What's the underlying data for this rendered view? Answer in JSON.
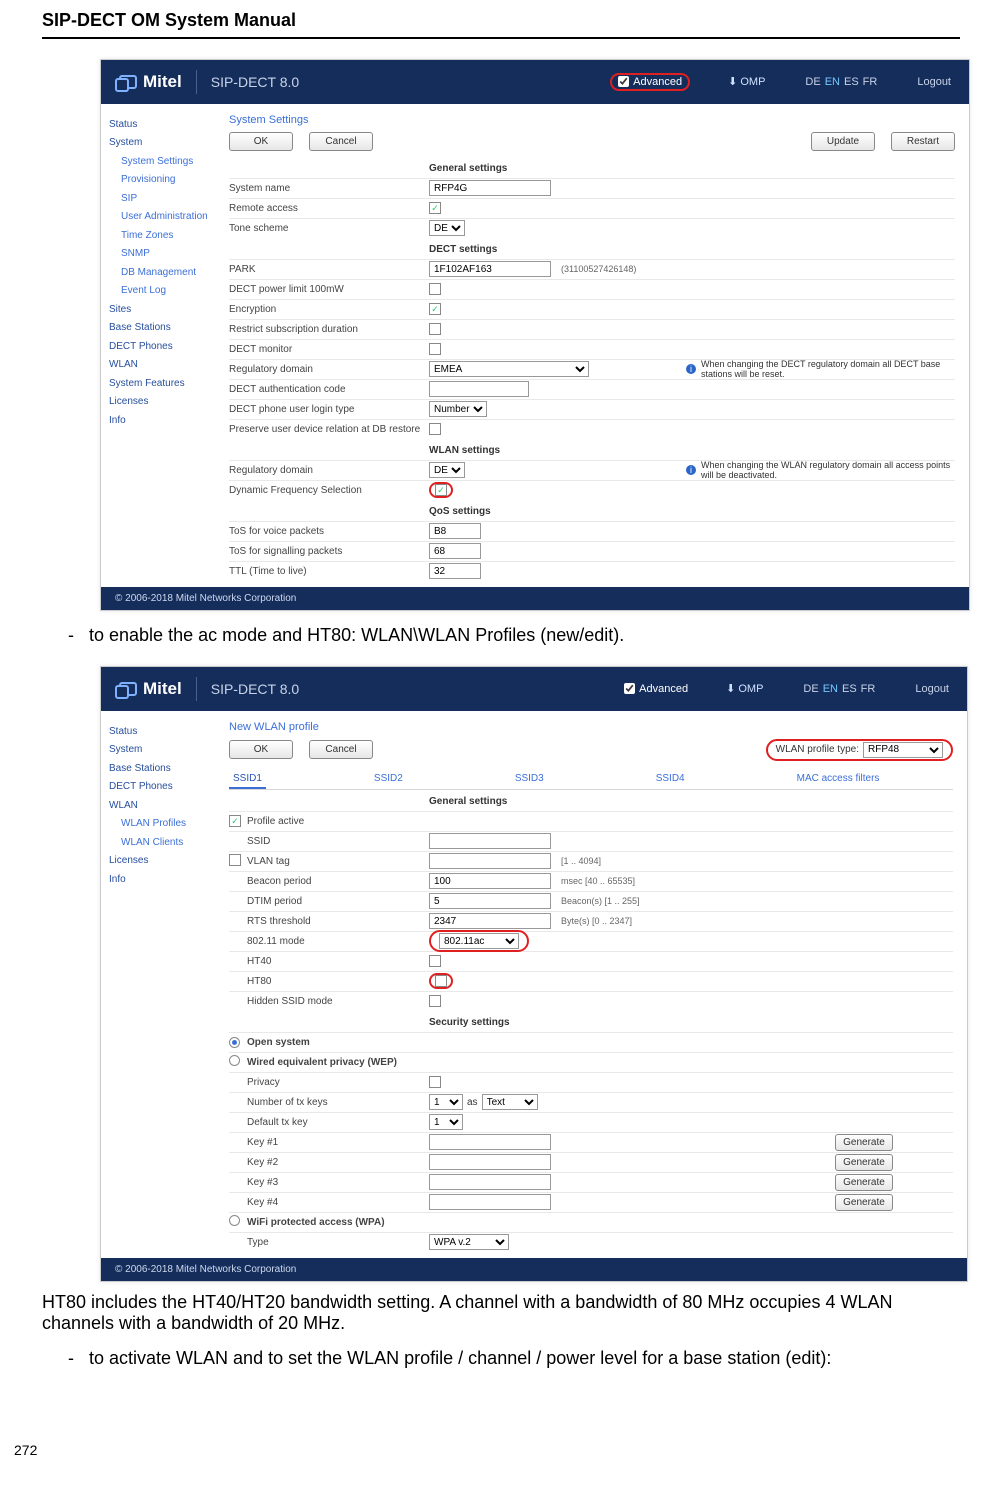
{
  "doc": {
    "header": "SIP-DECT OM System Manual",
    "page_num": "272"
  },
  "captions": {
    "c1": "-   to enable the ac mode and HT80: WLAN\\WLAN Profiles (new/edit).",
    "body": "HT80 includes the HT40/HT20 bandwidth setting. A channel with a bandwidth of 80 MHz occupies 4 WLAN channels with a bandwidth of 20 MHz.",
    "c2": "-   to activate WLAN and to set the WLAN profile / channel / power level for a base station (edit):"
  },
  "ui": {
    "brand": "Mitel",
    "product": "SIP-DECT 8.0",
    "advanced": "Advanced",
    "omp": "OMP",
    "langs": {
      "de": "DE",
      "en": "EN",
      "es": "ES",
      "fr": "FR"
    },
    "logout": "Logout",
    "copyright": "© 2006-2018 Mitel Networks Corporation",
    "ok": "OK",
    "cancel": "Cancel",
    "update": "Update",
    "restart": "Restart",
    "generate": "Generate"
  },
  "shot1": {
    "nav": [
      "Status",
      "System",
      "System Settings",
      "Provisioning",
      "SIP",
      "User Administration",
      "Time Zones",
      "SNMP",
      "DB Management",
      "Event Log",
      "Sites",
      "Base Stations",
      "DECT Phones",
      "WLAN",
      "System Features",
      "Licenses",
      "Info"
    ],
    "title": "System Settings",
    "hdr": {
      "gen": "General settings",
      "dect": "DECT settings",
      "wlan": "WLAN settings",
      "qos": "QoS settings"
    },
    "lbl": {
      "sysname": "System name",
      "remote": "Remote access",
      "tone": "Tone scheme",
      "park": "PARK",
      "pwr": "DECT power limit 100mW",
      "enc": "Encryption",
      "restrict": "Restrict subscription duration",
      "monitor": "DECT monitor",
      "regd": "Regulatory domain",
      "auth": "DECT authentication code",
      "login": "DECT phone user login type",
      "preserve": "Preserve user device relation at DB restore",
      "regd2": "Regulatory domain",
      "dfs": "Dynamic Frequency Selection",
      "tosv": "ToS for voice packets",
      "toss": "ToS for signalling packets",
      "ttl": "TTL (Time to live)"
    },
    "val": {
      "sysname": "RFP4G",
      "tone": "DE",
      "park": "1F102AF163",
      "park_note": "(31100527426148)",
      "regd": "EMEA",
      "login": "Number",
      "regd2": "DE",
      "tosv": "B8",
      "toss": "68",
      "ttl": "32"
    },
    "info": {
      "dect": "When changing the DECT regulatory domain all DECT base stations will be reset.",
      "wlan": "When changing the WLAN regulatory domain all access points will be deactivated."
    }
  },
  "shot2": {
    "nav": [
      "Status",
      "System",
      "Base Stations",
      "DECT Phones",
      "WLAN",
      "WLAN Profiles",
      "WLAN Clients",
      "Licenses",
      "Info"
    ],
    "title": "New WLAN profile",
    "profile_type_lbl": "WLAN profile type:",
    "profile_type": "RFP48",
    "tabs": [
      "SSID1",
      "SSID2",
      "SSID3",
      "SSID4",
      "MAC access filters"
    ],
    "hdr": {
      "gen": "General settings",
      "sec": "Security settings"
    },
    "lbl": {
      "active": "Profile active",
      "ssid": "SSID",
      "vlan": "VLAN tag",
      "beacon": "Beacon period",
      "dtim": "DTIM period",
      "rts": "RTS threshold",
      "mode": "802.11 mode",
      "ht40": "HT40",
      "ht80": "HT80",
      "hidden": "Hidden SSID mode",
      "open": "Open system",
      "wep": "Wired equivalent privacy (WEP)",
      "priv": "Privacy",
      "numkeys": "Number of tx keys",
      "defkey": "Default tx key",
      "k1": "Key #1",
      "k2": "Key #2",
      "k3": "Key #3",
      "k4": "Key #4",
      "wpa": "WiFi protected access (WPA)",
      "type": "Type"
    },
    "val": {
      "beacon": "100",
      "dtim": "5",
      "rts": "2347",
      "mode": "802.11ac",
      "numkeys": "1",
      "numkeys_as": "as",
      "numkeys_text": "Text",
      "defkey": "1",
      "wpatype": "WPA v.2"
    },
    "note": {
      "vlan": "[1 .. 4094]",
      "beacon": "msec [40 .. 65535]",
      "dtim": "Beacon(s) [1 .. 255]",
      "rts": "Byte(s) [0 .. 2347]"
    }
  }
}
